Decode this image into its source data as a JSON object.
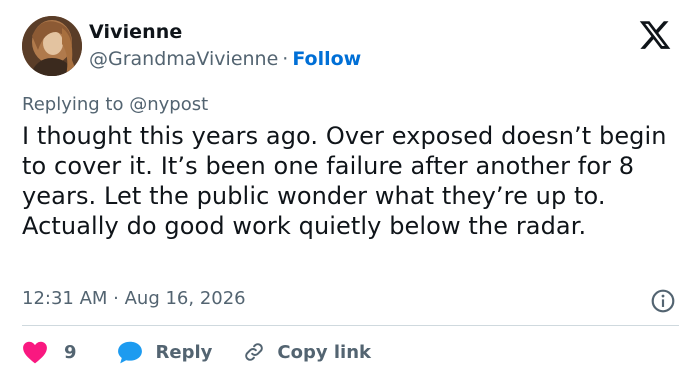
{
  "author": {
    "name": "Vivienne",
    "handle": "@GrandmaVivienne",
    "separator": "·",
    "follow_label": "Follow"
  },
  "reply_context": {
    "prefix": "Replying to",
    "target": "@nypost"
  },
  "tweet": {
    "text": "I thought this years ago. Over exposed doesn’t begin to cover it. It’s been one failure after another for 8 years. Let the public wonder what they’re up to. Actually do good work quietly below the radar.",
    "timestamp": "12:31 AM · Aug 16, 2026"
  },
  "actions": {
    "like_count": "9",
    "reply_label": "Reply",
    "copy_link_label": "Copy link"
  },
  "colors": {
    "accent": "#006fd6",
    "like": "#f91880",
    "reply": "#1d9bf0",
    "secondary_text": "#536471",
    "divider": "#cfd9de"
  },
  "icons": [
    "avatar-photo",
    "x-logo-icon",
    "info-icon",
    "heart-icon",
    "reply-bubble-icon",
    "link-icon"
  ]
}
